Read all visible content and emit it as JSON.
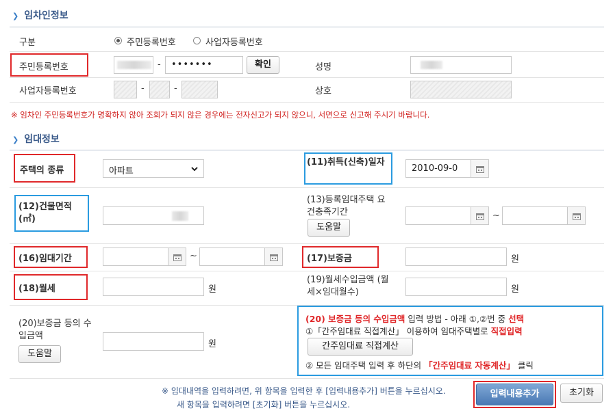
{
  "lessee_section": {
    "title": "임차인정보",
    "category_label": "구분",
    "radio_resident": "주민등록번호",
    "radio_business": "사업자등록번호",
    "resident_label": "주민등록번호",
    "resident_mask": "•••••••",
    "confirm_button": "확인",
    "name_label": "성명",
    "business_label": "사업자등록번호",
    "trade_label": "상호",
    "warning": "※ 임차인 주민등록번호가 명확하지 않아 조회가 되지 않은 경우에는 전자신고가 되지 않으니, 서면으로 신고해 주시기 바랍니다."
  },
  "rental_section": {
    "title": "임대정보",
    "house_type_label": "주택의 종류",
    "house_type_value": "아파트",
    "acq_date_label": "(11)취득(신축)일자",
    "acq_date_value": "2010-09-0",
    "area_label": "(12)건물면적(㎡)",
    "req_period_label": "(13)등록임대주택 요건충족기간",
    "help_button": "도움말",
    "lease_period_label": "(16)임대기간",
    "deposit_label": "(17)보증금",
    "monthly_label": "(18)월세",
    "monthly_income_label": "(19)월세수입금액 (월세×임대월수)",
    "deposit_income_label": "(20)보증금 등의 수입금액",
    "help_button2": "도움말",
    "tilde": "~",
    "won": "원"
  },
  "method_box": {
    "line1_red": "(20) 보증금 등의 수입금액",
    "line1_mid": "입력 방법 - 아래 ①,②번 중",
    "line1_end": "선택",
    "line2_a": "①「간주임대료 직접계산」 이용하여 임대주택별로",
    "line2_b": "직접입력",
    "calc_button": "간주임대료 직접계산",
    "line3_a": "② 모든 임대주택 입력 후 하단의",
    "line3_b": "「간주임대료 자동계산」",
    "line3_c": "클릭"
  },
  "footer": {
    "note1": "※ 임대내역을 입력하려면, 위 항목을 입력한 후 [입력내용추가] 버튼을 누르십시오.",
    "note2": "새 항목을 입력하려면 [초기화] 버튼을 누르십시오.",
    "add_button": "입력내용추가",
    "reset_button": "초기화"
  }
}
